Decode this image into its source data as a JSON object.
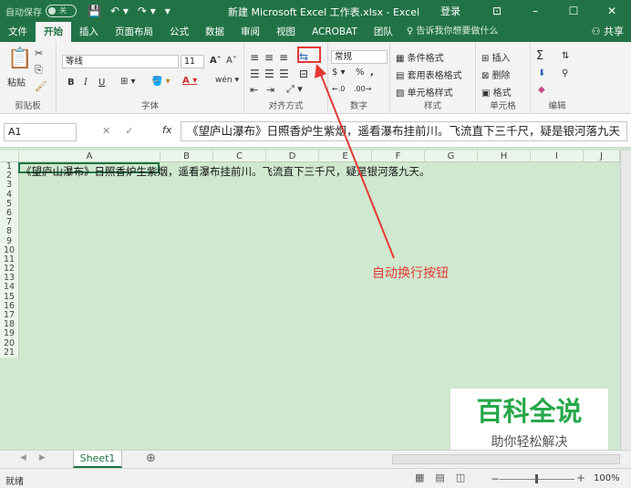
{
  "titlebar": {
    "autosave": "自动保存",
    "toggle": "关",
    "qat": [
      "💾",
      "↶ ▾",
      "↷ ▾",
      "▾"
    ],
    "title": "新建 Microsoft Excel 工作表.xlsx - Excel",
    "login": "登录",
    "restore": "⊡",
    "minimize": "–",
    "maximize": "☐",
    "close": "✕"
  },
  "tabs": [
    "文件",
    "开始",
    "插入",
    "页面布局",
    "公式",
    "数据",
    "审阅",
    "视图",
    "ACROBAT",
    "团队"
  ],
  "tell_me": "告诉我你想要做什么",
  "share": "共享",
  "ribbon": {
    "clipboard": {
      "paste": "粘贴",
      "label": "剪贴板"
    },
    "font": {
      "name": "等线",
      "size": "11",
      "bold": "B",
      "italic": "I",
      "underline": "U",
      "grow": "A˄",
      "shrink": "A˅",
      "label": "字体"
    },
    "align": {
      "label": "对齐方式"
    },
    "number": {
      "format": "常规",
      "percent": "%",
      "comma": ",",
      "label": "数字"
    },
    "styles": {
      "cond": "条件格式",
      "table": "套用表格格式",
      "cell": "单元格样式",
      "label": "样式"
    },
    "cells": {
      "insert": "插入",
      "delete": "删除",
      "format": "格式",
      "label": "单元格"
    },
    "editing": {
      "sum": "Σ",
      "label": "编辑"
    }
  },
  "annotation": "自动换行按钮",
  "formula": {
    "namebox": "A1",
    "fx": "fx",
    "value": "《望庐山瀑布》日照香炉生紫烟，遥看瀑布挂前川。飞流直下三千尺，疑是银河落九天"
  },
  "columns": [
    "A",
    "B",
    "C",
    "D",
    "E",
    "F",
    "G",
    "H",
    "I",
    "J"
  ],
  "rows": [
    "1",
    "2",
    "3",
    "4",
    "5",
    "6",
    "7",
    "8",
    "9",
    "10",
    "11",
    "12",
    "13",
    "14",
    "15",
    "16",
    "17",
    "18",
    "19",
    "20",
    "21"
  ],
  "cell_a1": "《望庐山瀑布》日照香炉生紫烟，遥看瀑布挂前川。飞流直下三千尺，疑是银河落九天。",
  "sheet": "Sheet1",
  "status": "就绪",
  "zoom": "100%",
  "watermark": {
    "line1": "百科全说",
    "line2": "助你轻松解决"
  },
  "colors": {
    "excel_green": "#217346",
    "highlight": "#e53935",
    "grid_tint": "#cfe8cf"
  }
}
